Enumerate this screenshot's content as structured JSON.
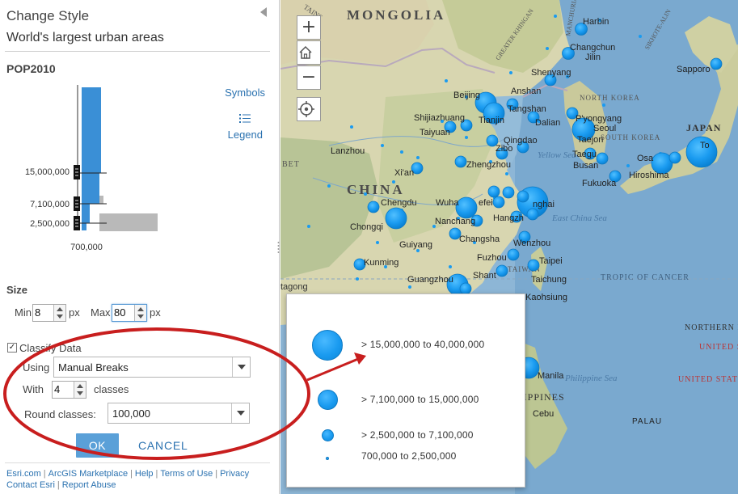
{
  "panel": {
    "title": "Change Style",
    "layer_name": "World's largest urban areas",
    "field": "POP2010",
    "symbols_link": "Symbols",
    "legend_link": "Legend",
    "histogram": {
      "break_labels": [
        "15,000,000",
        "7,100,000",
        "2,500,000"
      ],
      "min_label": "700,000"
    },
    "size": {
      "heading": "Size",
      "min_label": "Min",
      "min_value": "8",
      "min_unit": "px",
      "max_label": "Max",
      "max_value": "80",
      "max_unit": "px"
    },
    "classify": {
      "checkbox_label": "Classify Data",
      "checked": true,
      "using_label": "Using",
      "using_value": "Manual Breaks",
      "with_label": "With",
      "classes_value": "4",
      "classes_label": "classes",
      "round_label": "Round classes:",
      "round_value": "100,000"
    },
    "buttons": {
      "ok": "OK",
      "cancel": "CANCEL"
    },
    "footer": {
      "links_row1": [
        "Esri.com",
        "ArcGIS Marketplace",
        "Help",
        "Terms of Use",
        "Privacy"
      ],
      "links_row2": [
        "Contact Esri",
        "Report Abuse"
      ]
    }
  },
  "map": {
    "controls": {
      "zoom_in": "+",
      "home": "home-icon",
      "zoom_out": "−",
      "locate": "locate-icon"
    },
    "labels": {
      "mongolia": "MONGOLIA",
      "china": "CHINA",
      "japan": "JAPAN",
      "north_korea": "NORTH KOREA",
      "south_korea": "SOUTH KOREA",
      "yellow_sea": "Yellow Sea",
      "east_china_sea": "East China Sea",
      "taiwan": "TAIWAN",
      "philippine_sea": "Philippine Sea",
      "philippines": "PHILIPPINES",
      "tropic": "TROPIC OF CANCER",
      "northern_isl": "NORTHERN ISL",
      "united_st1": "UNITED ST",
      "united_st2": "UNITED STATE",
      "sikhote": "SIKHOTE-ALIN",
      "greater_khingan": "GREATER KHINGAN",
      "manchurian_plain": "MANCHURIAN PLAIN",
      "tains": "TAINS",
      "bet": "BET",
      "tagong": "tagong"
    },
    "cities": {
      "harbin": "Harbin",
      "changchun": "Changchun",
      "jilin": "Jilin",
      "shenyang": "Shenyang",
      "anshan": "Anshan",
      "beijing": "Beijing",
      "tangshan": "Tangshan",
      "tianjin": "Tianjin",
      "dalian": "Dalian",
      "shijiazhuang": "Shijiazhuang",
      "taiyuan": "Taiyuan",
      "pyongyang": "P'yongyang",
      "seoul": "Seoul",
      "taejon": "Taejon",
      "taegu": "Taegu",
      "busan": "Busan",
      "fukuoka": "Fukuoka",
      "hiroshima": "Hiroshima",
      "osaka": "Osa",
      "sapporo": "Sapporo",
      "tokyo": "To",
      "lanzhou": "Lanzhou",
      "qingdao": "Qingdao",
      "zibo": "Zibo",
      "zhengzhou": "Zhengzhou",
      "xian": "Xi'an",
      "chengdu": "Chengdu",
      "wuhan": "Wuha",
      "hefei": "efei",
      "shanghai": "nghai",
      "hangzhou": "Hangzh",
      "chongqing": "Chongqi",
      "nanchang": "Nanchang",
      "changsha": "Changsha",
      "wenzhou": "Wenzhou",
      "guiyang": "Guiyang",
      "kunming": "Kunming",
      "fuzhou": "Fuzhou",
      "taipei": "Taipei",
      "taichung": "Taichung",
      "guangzhou": "Guangzhou",
      "shantou": "Shant",
      "kaohsiung": "Kaohsiung",
      "manila": "Manila",
      "cebu": "Cebu",
      "palau": "PALAU"
    }
  },
  "legend_popup": {
    "classes": [
      "> 15,000,000 to 40,000,000",
      "> 7,100,000 to 15,000,000",
      "> 2,500,000 to 7,100,000",
      "700,000 to 2,500,000"
    ]
  },
  "colors": {
    "accent": "#2b72b0",
    "ok_button": "#5aa0d8",
    "symbol": "#1a9bf0",
    "histogram_bar": "#3a8fd6",
    "annotation": "#c81e1e"
  }
}
